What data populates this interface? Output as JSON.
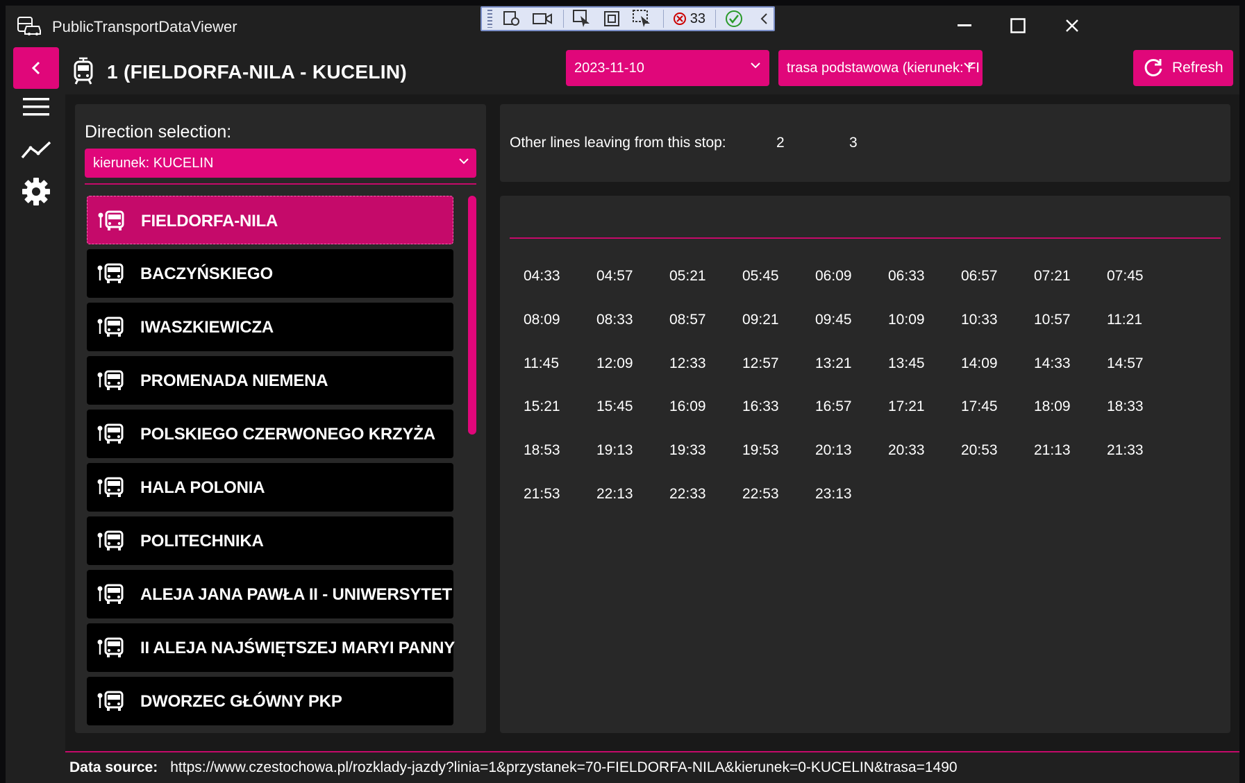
{
  "window": {
    "title": "PublicTransportDataViewer"
  },
  "debug_toolbar": {
    "count": "33"
  },
  "header": {
    "route_title": "1 (FIELDORFA-NILA - KUCELIN)",
    "date_value": "2023-11-10",
    "route_variant_value": "trasa podstawowa (kierunek: FI",
    "refresh_label": "Refresh"
  },
  "direction": {
    "label": "Direction selection:",
    "selected": "kierunek: KUCELIN"
  },
  "stops": [
    "FIELDORFA-NILA",
    "BACZYŃSKIEGO",
    "IWASZKIEWICZA",
    "PROMENADA NIEMENA",
    "POLSKIEGO CZERWONEGO KRZYŻA",
    "HALA POLONIA",
    "POLITECHNIKA",
    "ALEJA JANA PAWŁA II - UNIWERSYTET",
    "II ALEJA NAJŚWIĘTSZEJ MARYI PANNY",
    "DWORZEC GŁÓWNY PKP"
  ],
  "selected_stop_index": 0,
  "other_lines": {
    "label": "Other lines leaving from this stop:",
    "lines": [
      "2",
      "3"
    ]
  },
  "departures": [
    "04:33",
    "04:57",
    "05:21",
    "05:45",
    "06:09",
    "06:33",
    "06:57",
    "07:21",
    "07:45",
    "08:09",
    "08:33",
    "08:57",
    "09:21",
    "09:45",
    "10:09",
    "10:33",
    "10:57",
    "11:21",
    "11:45",
    "12:09",
    "12:33",
    "12:57",
    "13:21",
    "13:45",
    "14:09",
    "14:33",
    "14:57",
    "15:21",
    "15:45",
    "16:09",
    "16:33",
    "16:57",
    "17:21",
    "17:45",
    "18:09",
    "18:33",
    "18:53",
    "19:13",
    "19:33",
    "19:53",
    "20:13",
    "20:33",
    "20:53",
    "21:13",
    "21:33",
    "21:53",
    "22:13",
    "22:33",
    "22:53",
    "23:13"
  ],
  "footer": {
    "label": "Data source:",
    "url": "https://www.czestochowa.pl/rozklady-jazdy?linia=1&przystanek=70-FIELDORFA-NILA&kierunek=0-KUCELIN&trasa=1490"
  },
  "colors": {
    "accent": "#e0077a",
    "accent_dark": "#c50a6a",
    "background": "#202020",
    "panel": "#282828"
  }
}
